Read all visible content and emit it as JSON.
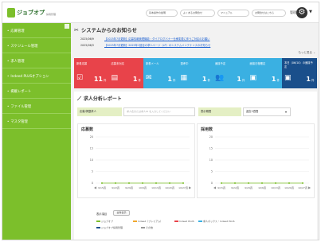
{
  "header": {
    "logo_text": "ジョブオプ",
    "logo_sub": "採用管理",
    "buttons": [
      "基本操作の説明",
      "よくあるお問合せ",
      "マニュアル",
      "お問合せはこちら"
    ],
    "user_name": "管理",
    "colors": {
      "accent": "#7cbf2b",
      "header_bg": "#ffffff"
    }
  },
  "sidebar": {
    "items": [
      {
        "label": "応募管理"
      },
      {
        "label": "スケジュール管理"
      },
      {
        "label": "求人管理"
      },
      {
        "label": "Indeed PLUSオプション"
      },
      {
        "label": "掲載レポート"
      },
      {
        "label": "ファイル管理"
      },
      {
        "label": "マスタ管理"
      }
    ]
  },
  "notices": {
    "title": "システムからのお知らせ",
    "items": [
      {
        "date": "2025/06/9",
        "text": "【2025年7月更新】応募情報管理機能・ダイアログバナー仕様変更に伴うご対応のお願い"
      },
      {
        "date": "2025/06/3",
        "text": "【2025年7月更新】2025年1回目の求人ページ（LP）のシステムメンテナンスのお知らせ"
      }
    ],
    "more_label": "もっと見る"
  },
  "tiles": [
    {
      "label": "新着応募",
      "icon": "check-icon",
      "value": "11",
      "unit": "件",
      "color": "#e8434a"
    },
    {
      "label": "応募未対応",
      "icon": "document-icon",
      "value": "1",
      "unit": "件",
      "color": "#e8434a"
    },
    {
      "label": "新着メール",
      "icon": "mail-icon",
      "value": "1",
      "unit": "件",
      "color": "#3ab0e2"
    },
    {
      "label": "選考中",
      "icon": "file-icon",
      "value": "1",
      "unit": "件",
      "color": "#3ab0e2"
    },
    {
      "label": "面接予定",
      "icon": "users-icon",
      "value": "1",
      "unit": "件",
      "color": "#3ab0e2"
    },
    {
      "label": "面接日程確定",
      "icon": "calendar-icon",
      "value": "1",
      "unit": "件",
      "color": "#3ab0e2"
    },
    {
      "label": "本日（06/10）の面接予定",
      "icon": "calendar-icon",
      "value": "1",
      "unit": "件",
      "color": "#1a4f8b"
    }
  ],
  "analysis": {
    "title": "求人分析レポート",
    "filter_job_label": "応募/掲載求人",
    "filter_job_placeholder": "求人名または求人ID を入力してください",
    "filter_period_label": "表示期間",
    "filter_period_value": "過去2週間"
  },
  "chart_data": [
    {
      "type": "line",
      "title": "応募数",
      "categories": [
        "9/15週",
        "9/22週",
        "9/29週",
        "10/6週",
        "10/13週",
        "10/20週",
        "10/27週"
      ],
      "series": [
        {
          "values": [
            0,
            0,
            0,
            0,
            0,
            0,
            0
          ]
        }
      ],
      "yticks": [
        "20",
        "15",
        "10",
        "5",
        "0"
      ],
      "ylim": [
        0,
        20
      ]
    },
    {
      "type": "line",
      "title": "採用数",
      "categories": [
        "9/15週",
        "9/22週",
        "9/29週",
        "10/6週",
        "10/13週",
        "10/20週",
        "10/27週"
      ],
      "series": [
        {
          "values": [
            0,
            0,
            0,
            0,
            0,
            0,
            0
          ]
        }
      ],
      "yticks": [
        "20",
        "15",
        "10",
        "5",
        "0"
      ],
      "ylim": [
        0,
        20
      ]
    }
  ],
  "legend": {
    "title": "表示項目",
    "button_label": "全件表示",
    "items": [
      {
        "label": "ジョブオプ",
        "color": "#7cbf2b"
      },
      {
        "label": "Indeed（プレミアム）",
        "color": "#f0a830"
      },
      {
        "label": "Indeed PLUS",
        "color": "#e8434a"
      },
      {
        "label": "求人ボックス・Indeed PLUS",
        "color": "#3ab0e2"
      },
      {
        "label": "ジョブオプ採用管理",
        "color": "#1a4f8b"
      },
      {
        "label": "その他",
        "color": "#999999"
      }
    ]
  }
}
